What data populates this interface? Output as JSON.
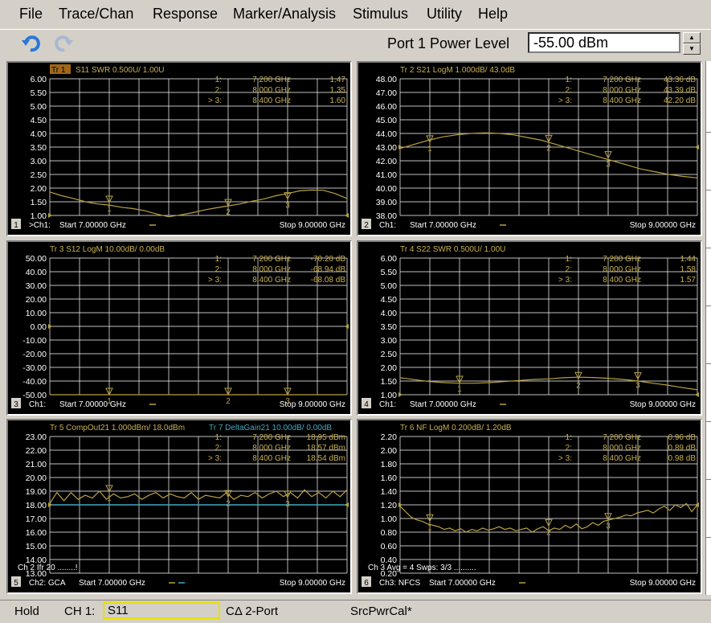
{
  "menu": [
    "File",
    "Trace/Chan",
    "Response",
    "Marker/Analysis",
    "Stimulus",
    "Utility",
    "Help"
  ],
  "toolbar": {
    "undo_icon": "undo-arrow-icon",
    "redo_icon": "redo-arrow-icon",
    "power_label": "Port 1 Power Level",
    "power_value": "-55.00 dBm"
  },
  "colors": {
    "trace": "#b8a040",
    "trace_header": "#c8b050",
    "teal": "#40a8c0",
    "grid": "#ffffff",
    "background": "#000000"
  },
  "windows": [
    {
      "num": "1",
      "header": "S11 SWR 0.500U/  1.00U",
      "header_prefix": "Tr 1",
      "header_prefix_active": true,
      "header2": "",
      "yticks": [
        "6.00",
        "5.50",
        "5.00",
        "4.50",
        "4.00",
        "3.50",
        "3.00",
        "2.50",
        "2.00",
        "1.50",
        "1.00"
      ],
      "markers": [
        {
          "idx": "1:",
          "freq": "7.200 GHz",
          "val": "1.47"
        },
        {
          "idx": "2:",
          "freq": "8.000 GHz",
          "val": "1.35"
        },
        {
          "idx": "> 3:",
          "freq": "8.400 GHz",
          "val": "1.60"
        }
      ],
      "footer_ch": ">Ch1:",
      "footer_start": "Start  7.00000 GHz",
      "footer_stop": "Stop  9.00000 GHz",
      "overlay_text": "",
      "trace_y": [
        1.86,
        1.72,
        1.62,
        1.5,
        1.42,
        1.38,
        1.3,
        1.25,
        1.17,
        1.05,
        0.95,
        1.02,
        1.1,
        1.2,
        1.28,
        1.35,
        1.42,
        1.52,
        1.6,
        1.72,
        1.8,
        1.9,
        1.93,
        1.92,
        1.8,
        1.62
      ],
      "ymin": 1.0,
      "ymax": 6.0,
      "refval": 1.0,
      "marker_pos": [
        {
          "x": 0.2,
          "y": 1.47,
          "label": "1"
        },
        {
          "x": 0.6,
          "y": 1.35,
          "label": "2"
        },
        {
          "x": 0.8,
          "y": 1.6,
          "label": "3"
        }
      ]
    },
    {
      "num": "2",
      "header": "Tr  2  S21 LogM 1.000dB/  43.0dB",
      "header_prefix": "",
      "header_prefix_active": false,
      "header2": "",
      "yticks": [
        "48.00",
        "47.00",
        "46.00",
        "45.00",
        "44.00",
        "43.00",
        "42.00",
        "41.00",
        "40.00",
        "39.00",
        "38.00"
      ],
      "markers": [
        {
          "idx": "1:",
          "freq": "7.200 GHz",
          "val": "43.36 dB"
        },
        {
          "idx": "2:",
          "freq": "8.000 GHz",
          "val": "43.39 dB"
        },
        {
          "idx": "> 3:",
          "freq": "8.400 GHz",
          "val": "42.20 dB"
        }
      ],
      "footer_ch": "Ch1:",
      "footer_start": "Start  7.00000 GHz",
      "footer_stop": "Stop  9.00000 GHz",
      "overlay_text": "",
      "trace_y": [
        42.9,
        43.2,
        43.5,
        43.75,
        43.9,
        44.0,
        44.05,
        44.0,
        43.9,
        43.7,
        43.5,
        43.2,
        42.9,
        42.6,
        42.3,
        42.0,
        41.7,
        41.4,
        41.2,
        41.0,
        40.85,
        40.75
      ],
      "ymin": 38.0,
      "ymax": 48.0,
      "refval": 43.0,
      "marker_pos": [
        {
          "x": 0.1,
          "y": 43.36,
          "label": "1"
        },
        {
          "x": 0.5,
          "y": 43.39,
          "label": "2"
        },
        {
          "x": 0.7,
          "y": 42.2,
          "label": "3"
        }
      ]
    },
    {
      "num": "3",
      "header": "Tr  3  S12 LogM 10.00dB/  0.00dB",
      "header_prefix": "",
      "header_prefix_active": false,
      "header2": "",
      "yticks": [
        "50.00",
        "40.00",
        "30.00",
        "20.00",
        "10.00",
        "0.00",
        "-10.00",
        "-20.00",
        "-30.00",
        "-40.00",
        "-50.00"
      ],
      "markers": [
        {
          "idx": "1:",
          "freq": "7.200 GHz",
          "val": "-70.20 dB"
        },
        {
          "idx": "2:",
          "freq": "8.000 GHz",
          "val": "-68.94 dB"
        },
        {
          "idx": "> 3:",
          "freq": "8.400 GHz",
          "val": "-68.08 dB"
        }
      ],
      "footer_ch": "Ch1:",
      "footer_start": "Start  7.00000 GHz",
      "footer_stop": "Stop  9.00000 GHz",
      "overlay_text": "",
      "trace_y": [
        -50,
        -50,
        -50,
        -50,
        -50,
        -50,
        -50,
        -50,
        -50,
        -50,
        -50,
        -50
      ],
      "ymin": -50.0,
      "ymax": 50.0,
      "refval": 0.0,
      "marker_pos": [
        {
          "x": 0.2,
          "y": -50,
          "label": "1"
        },
        {
          "x": 0.6,
          "y": -50,
          "label": "2"
        },
        {
          "x": 0.8,
          "y": -50,
          "label": "3"
        }
      ]
    },
    {
      "num": "4",
      "header": "Tr  4  S22 SWR 0.500U/  1.00U",
      "header_prefix": "",
      "header_prefix_active": false,
      "header2": "",
      "yticks": [
        "6.00",
        "5.50",
        "5.00",
        "4.50",
        "4.00",
        "3.50",
        "3.00",
        "2.50",
        "2.00",
        "1.50",
        "1.00"
      ],
      "markers": [
        {
          "idx": "1:",
          "freq": "7.200 GHz",
          "val": "1.44"
        },
        {
          "idx": "2:",
          "freq": "8.000 GHz",
          "val": "1.58"
        },
        {
          "idx": "> 3:",
          "freq": "8.400 GHz",
          "val": "1.57"
        }
      ],
      "footer_ch": "Ch1:",
      "footer_start": "Start  7.00000 GHz",
      "footer_stop": "Stop  9.00000 GHz",
      "overlay_text": "",
      "trace_y": [
        1.62,
        1.55,
        1.48,
        1.44,
        1.42,
        1.42,
        1.44,
        1.48,
        1.52,
        1.56,
        1.58,
        1.62,
        1.64,
        1.63,
        1.6,
        1.56,
        1.5,
        1.42,
        1.35,
        1.26,
        1.18
      ],
      "ymin": 1.0,
      "ymax": 6.0,
      "refval": 1.0,
      "marker_pos": [
        {
          "x": 0.2,
          "y": 1.44,
          "label": "1"
        },
        {
          "x": 0.6,
          "y": 1.58,
          "label": "2"
        },
        {
          "x": 0.8,
          "y": 1.57,
          "label": "3"
        }
      ]
    },
    {
      "num": "5",
      "header": "Tr  5  CompOut21 1.000dBm/  18.0dBm",
      "header_prefix": "",
      "header_prefix_active": false,
      "header2": "Tr  7  DeltaGain21 10.00dB/  0.00dB",
      "yticks": [
        "23.00",
        "22.00",
        "21.00",
        "20.00",
        "19.00",
        "18.00",
        "17.00",
        "16.00",
        "15.00",
        "14.00",
        "13.00"
      ],
      "markers": [
        {
          "idx": "1:",
          "freq": "7.200 GHz",
          "val": "18.95 dBm"
        },
        {
          "idx": "2:",
          "freq": "8.000 GHz",
          "val": "18.57 dBm"
        },
        {
          "idx": "> 3:",
          "freq": "8.400 GHz",
          "val": "18.54 dBm"
        }
      ],
      "footer_ch": "Ch2: GCA",
      "footer_start": "Start  7.00000 GHz",
      "footer_stop": "Stop  9.00000 GHz",
      "overlay_text": "Ch 2  Ifr 20 ........!",
      "trace_y": [
        18.1,
        18.9,
        18.3,
        18.9,
        18.4,
        18.7,
        18.5,
        19.0,
        18.4,
        18.8,
        18.5,
        18.6,
        18.8,
        18.4,
        18.7,
        18.9,
        18.5,
        18.8,
        18.6,
        18.5,
        18.9,
        18.4,
        18.7,
        18.6,
        18.5,
        18.9,
        18.4,
        18.7,
        18.6,
        18.9,
        18.5,
        18.8,
        19.0,
        18.6,
        18.9,
        18.5,
        19.1,
        18.6,
        18.9,
        18.5,
        19.0,
        18.6,
        19.1
      ],
      "teal_y": [
        18.0,
        18.0
      ],
      "ymin": 13.0,
      "ymax": 23.0,
      "refval": 18.0,
      "marker_pos": [
        {
          "x": 0.2,
          "y": 18.95,
          "label": "1"
        },
        {
          "x": 0.6,
          "y": 18.57,
          "label": "2"
        },
        {
          "x": 0.8,
          "y": 18.54,
          "label": "3"
        }
      ]
    },
    {
      "num": "6",
      "header": "Tr  6  NF LogM 0.200dB/  1.20dB",
      "header_prefix": "",
      "header_prefix_active": false,
      "header2": "",
      "yticks": [
        "2.20",
        "2.00",
        "1.80",
        "1.60",
        "1.40",
        "1.20",
        "1.00",
        "0.80",
        "0.60",
        "0.40",
        "0.20"
      ],
      "markers": [
        {
          "idx": "1:",
          "freq": "7.200 GHz",
          "val": "0.96 dB"
        },
        {
          "idx": "2:",
          "freq": "8.000 GHz",
          "val": "0.89 dB"
        },
        {
          "idx": "> 3:",
          "freq": "8.400 GHz",
          "val": "0.98 dB"
        }
      ],
      "footer_ch": "Ch3: NFCS",
      "footer_start": "Start  7.00000 GHz",
      "footer_stop": "Stop  9.00000 GHz",
      "overlay_text": "Ch 3 Avg =    4 Swps: 3/3 ..........",
      "trace_y": [
        1.18,
        1.1,
        1.02,
        0.98,
        0.96,
        0.92,
        0.9,
        0.88,
        0.84,
        0.86,
        0.82,
        0.85,
        0.8,
        0.84,
        0.82,
        0.86,
        0.83,
        0.85,
        0.88,
        0.84,
        0.86,
        0.82,
        0.84,
        0.86,
        0.8,
        0.85,
        0.88,
        0.82,
        0.86,
        0.84,
        0.9,
        0.86,
        0.92,
        0.85,
        0.88,
        0.94,
        0.9,
        0.96,
        0.98,
        1.0,
        1.02,
        1.05,
        1.04,
        1.08,
        1.1,
        1.12,
        1.08,
        1.14,
        1.18,
        1.12,
        1.2,
        1.16,
        1.22,
        1.1,
        1.2
      ],
      "ymin": 0.2,
      "ymax": 2.2,
      "refval": 1.2,
      "marker_pos": [
        {
          "x": 0.1,
          "y": 0.96,
          "label": "1"
        },
        {
          "x": 0.5,
          "y": 0.89,
          "label": "2"
        },
        {
          "x": 0.7,
          "y": 0.98,
          "label": "3"
        }
      ]
    }
  ],
  "status": {
    "hold": "Hold",
    "ch_label": "CH 1:",
    "ch_value": "S11",
    "port": "CΔ 2-Port",
    "cal": "SrcPwrCal*"
  }
}
